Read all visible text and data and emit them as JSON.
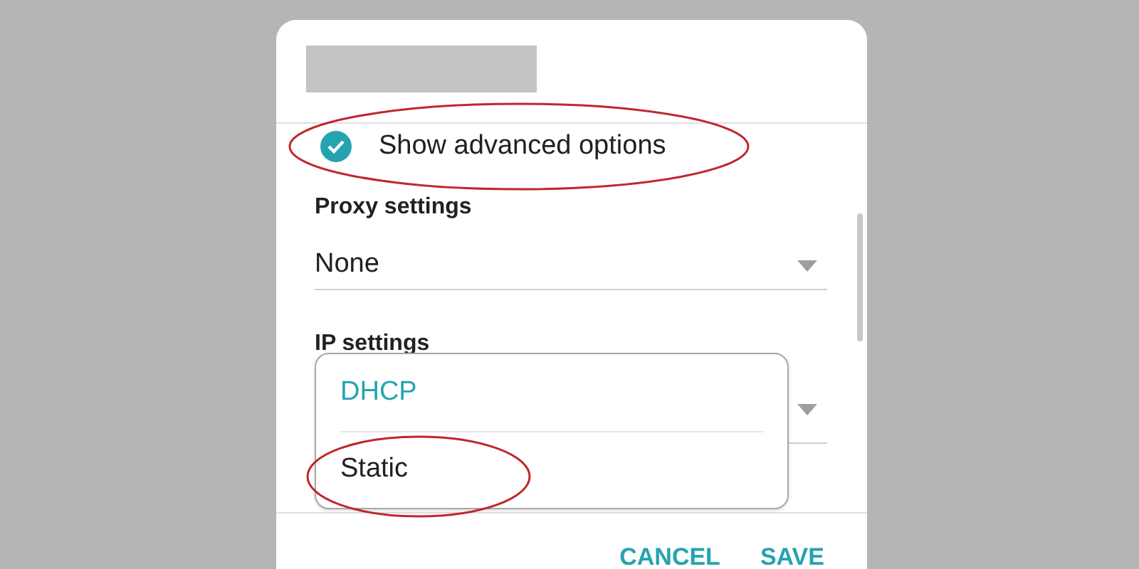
{
  "dialog": {
    "advanced_options": {
      "label": "Show advanced options",
      "checked": true
    },
    "proxy": {
      "label": "Proxy settings",
      "value": "None"
    },
    "ip": {
      "label": "IP settings",
      "menu": [
        {
          "label": "DHCP",
          "selected": true
        },
        {
          "label": "Static",
          "selected": false
        }
      ]
    },
    "buttons": [
      "CANCEL",
      "SAVE"
    ]
  }
}
